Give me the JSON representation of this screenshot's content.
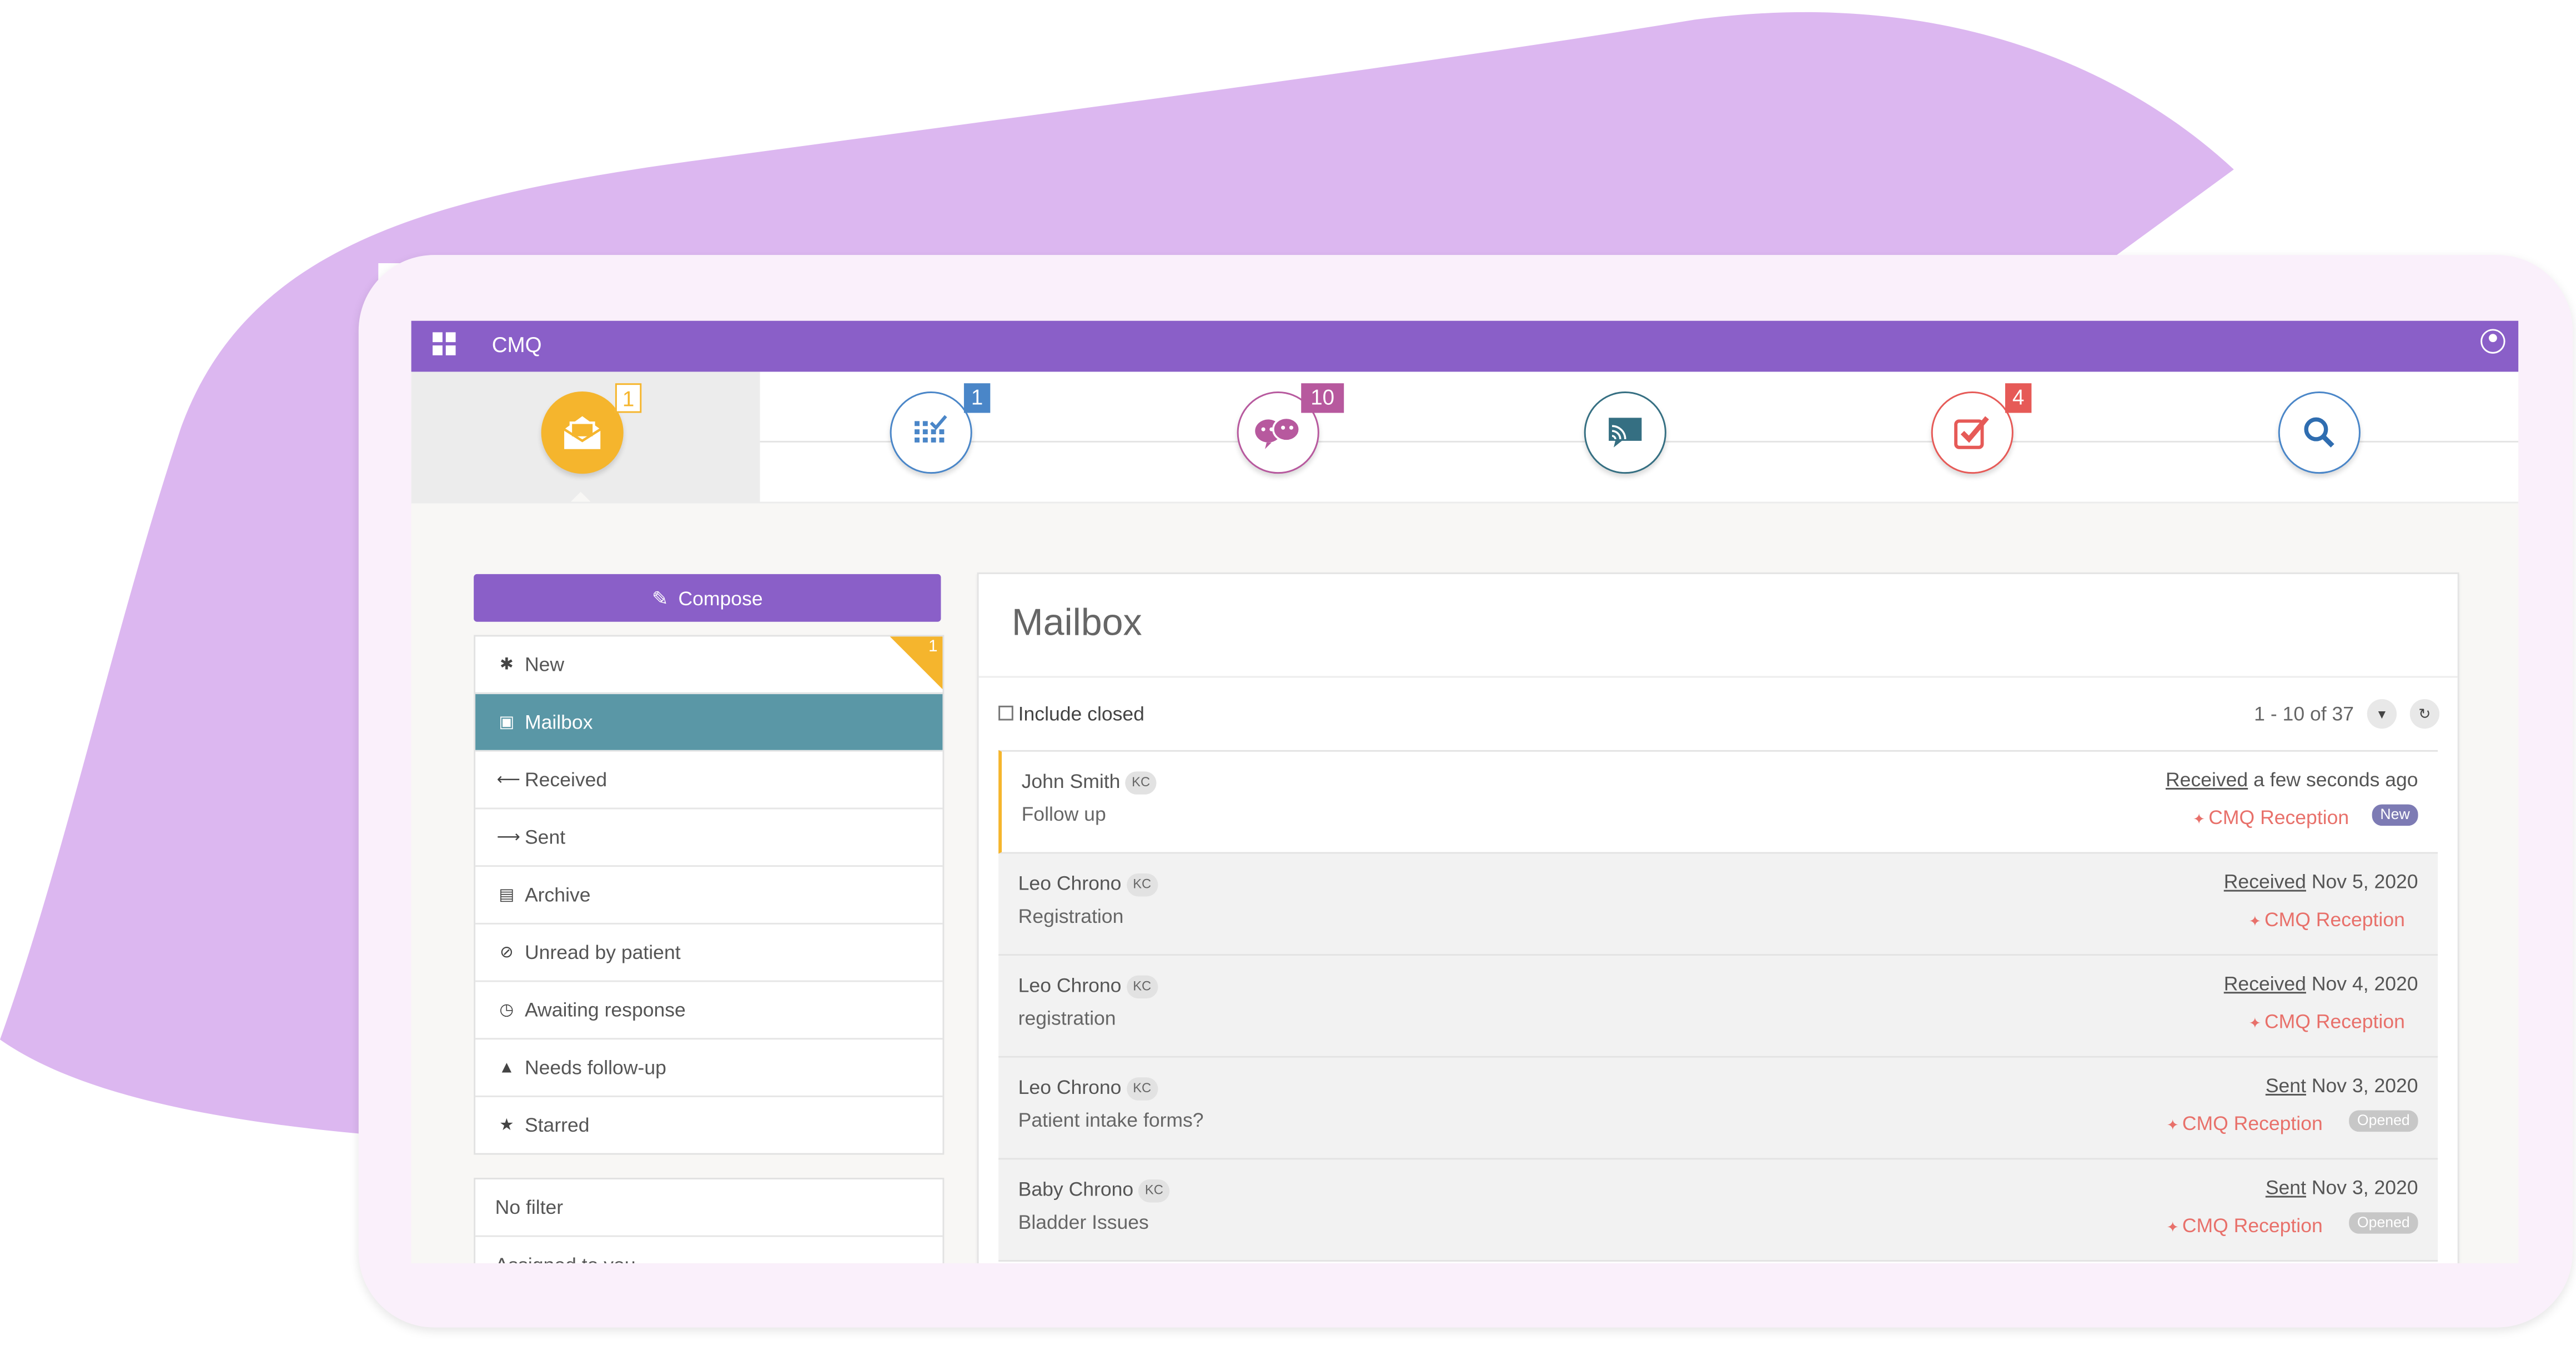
{
  "app": {
    "title": "CMQ"
  },
  "colors": {
    "brand": "#8a5fc8",
    "active_nav": "#5a97a6",
    "new_badge": "#7d7bb4",
    "opened_badge": "#c7c7c7",
    "location_text": "#e8706a",
    "blob": "#dcb7f0"
  },
  "nav_icons": [
    {
      "name": "mail-icon",
      "badge": "1",
      "active": true
    },
    {
      "name": "calendar-icon",
      "badge": "1"
    },
    {
      "name": "patients-icon",
      "badge": "10"
    },
    {
      "name": "broadcast-icon",
      "badge": ""
    },
    {
      "name": "tasks-icon",
      "badge": "4"
    },
    {
      "name": "search-icon",
      "badge": ""
    }
  ],
  "sidebar": {
    "compose_label": "Compose",
    "new_count": "1",
    "items": [
      {
        "label": "New",
        "icon": "asterisk-icon"
      },
      {
        "label": "Mailbox",
        "icon": "inbox-icon",
        "active": true
      },
      {
        "label": "Received",
        "icon": "arrow-left-icon"
      },
      {
        "label": "Sent",
        "icon": "arrow-right-icon"
      },
      {
        "label": "Archive",
        "icon": "archive-icon"
      },
      {
        "label": "Unread by patient",
        "icon": "eye-slash-icon"
      },
      {
        "label": "Awaiting response",
        "icon": "clock-icon"
      },
      {
        "label": "Needs follow-up",
        "icon": "warning-icon"
      },
      {
        "label": "Starred",
        "icon": "star-icon"
      }
    ],
    "filters": [
      "No filter",
      "Assigned to you"
    ]
  },
  "mailbox": {
    "title": "Mailbox",
    "include_closed_label": "Include closed",
    "include_closed": false,
    "pagination": "1 - 10 of 37",
    "messages": [
      {
        "name": "John Smith",
        "initials": "KC",
        "subject": "Follow up",
        "direction": "Received",
        "when": "a few seconds ago",
        "location": "CMQ Reception",
        "tag": "New"
      },
      {
        "name": "Leo Chrono",
        "initials": "KC",
        "subject": "Registration",
        "direction": "Received",
        "when": "Nov 5, 2020",
        "location": "CMQ Reception",
        "tag": ""
      },
      {
        "name": "Leo Chrono",
        "initials": "KC",
        "subject": "registration",
        "direction": "Received",
        "when": "Nov 4, 2020",
        "location": "CMQ Reception",
        "tag": ""
      },
      {
        "name": "Leo Chrono",
        "initials": "KC",
        "subject": "Patient intake forms?",
        "direction": "Sent",
        "when": "Nov 3, 2020",
        "location": "CMQ Reception",
        "tag": "Opened"
      },
      {
        "name": "Baby Chrono",
        "initials": "KC",
        "subject": "Bladder Issues",
        "direction": "Sent",
        "when": "Nov 3, 2020",
        "location": "CMQ Reception",
        "tag": "Opened"
      }
    ]
  }
}
